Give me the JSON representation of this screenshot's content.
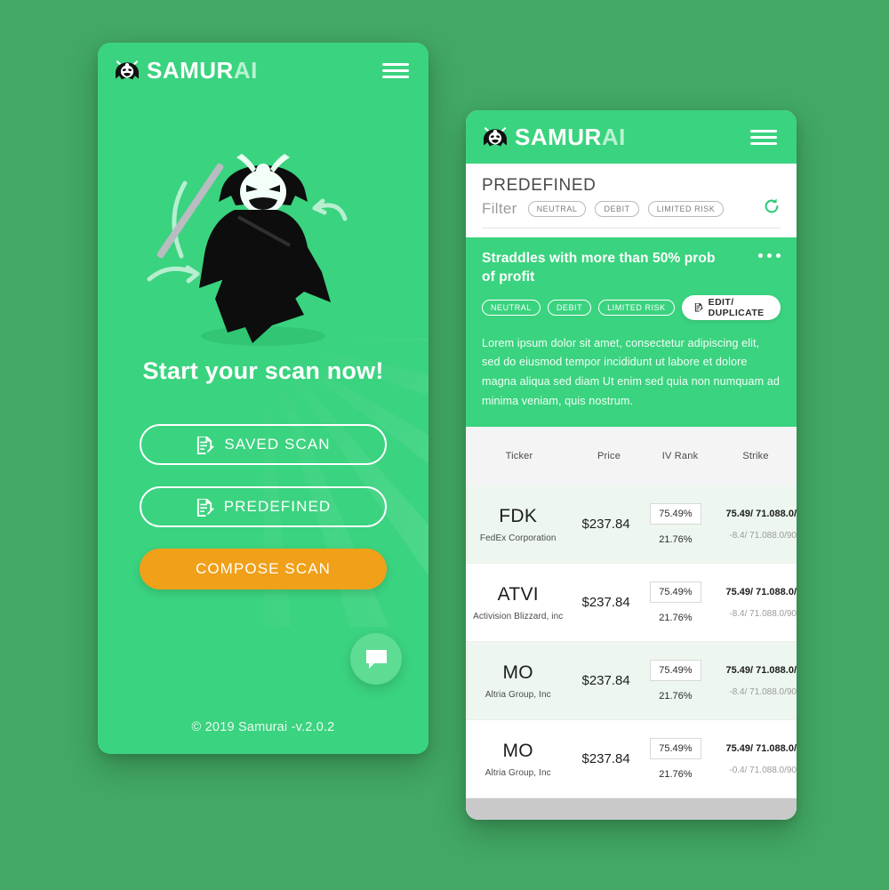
{
  "brand": {
    "name_main": "SAMUR",
    "name_accent": "AI",
    "mark": "samurai-helmet-icon"
  },
  "left_screen": {
    "headline": "Start your scan now!",
    "buttons": [
      {
        "label": "SAVED SCAN",
        "icon": "document-edit-icon",
        "style": "outline"
      },
      {
        "label": "PREDEFINED",
        "icon": "document-edit-icon",
        "style": "outline"
      },
      {
        "label": "COMPOSE SCAN",
        "icon": "",
        "style": "solid"
      }
    ],
    "fab_icon": "chat-bubble-icon",
    "copyright": "© 2019 Samurai -v.2.0.2"
  },
  "right_screen": {
    "filter": {
      "title": "PREDEFINED",
      "label": "Filter",
      "chips": [
        "NEUTRAL",
        "DEBIT",
        "LIMITED RISK"
      ],
      "refresh_icon": "refresh-icon"
    },
    "strategy": {
      "title": "Straddles with more than 50% prob of profit",
      "menu_icon": "more-options-icon",
      "chips": [
        "NEUTRAL",
        "DEBIT",
        "LIMITED RISK"
      ],
      "edit_button": {
        "label": "EDIT/ DUPLICATE",
        "icon": "document-edit-icon"
      },
      "description": "Lorem ipsum dolor sit amet, consectetur adipiscing elit, sed do eiusmod tempor incididunt ut labore et dolore magna aliqua sed diam Ut enim sed quia non numquam ad minima veniam, quis nostrum."
    },
    "table": {
      "headers": [
        "Ticker",
        "Price",
        "IV Rank",
        "Strike"
      ],
      "rows": [
        {
          "symbol": "FDK",
          "company": "FedEx Corporation",
          "price": "$237.84",
          "iv_rank": "75.49%",
          "iv_sub": "21.76%",
          "strike_main": "75.49/ 71.088.0/",
          "strike_sub": "-8.4/ 71.088.0/90"
        },
        {
          "symbol": "ATVI",
          "company": "Activision Blizzard, inc",
          "price": "$237.84",
          "iv_rank": "75.49%",
          "iv_sub": "21.76%",
          "strike_main": "75.49/ 71.088.0/",
          "strike_sub": "-8.4/ 71.088.0/90"
        },
        {
          "symbol": "MO",
          "company": "Altria Group, Inc",
          "price": "$237.84",
          "iv_rank": "75.49%",
          "iv_sub": "21.76%",
          "strike_main": "75.49/ 71.088.0/",
          "strike_sub": "-8.4/ 71.088.0/90"
        },
        {
          "symbol": "MO",
          "company": "Altria Group, Inc",
          "price": "$237.84",
          "iv_rank": "75.49%",
          "iv_sub": "21.76%",
          "strike_main": "75.49/ 71.088.0/",
          "strike_sub": "-0.4/ 71.088.0/90"
        }
      ]
    }
  },
  "colors": {
    "page_background": "#42a863",
    "brand_green": "#3ad37f",
    "accent_orange": "#f0a019",
    "accent_mint": "#b8f2d1",
    "row_alt": "#edf7ef"
  }
}
